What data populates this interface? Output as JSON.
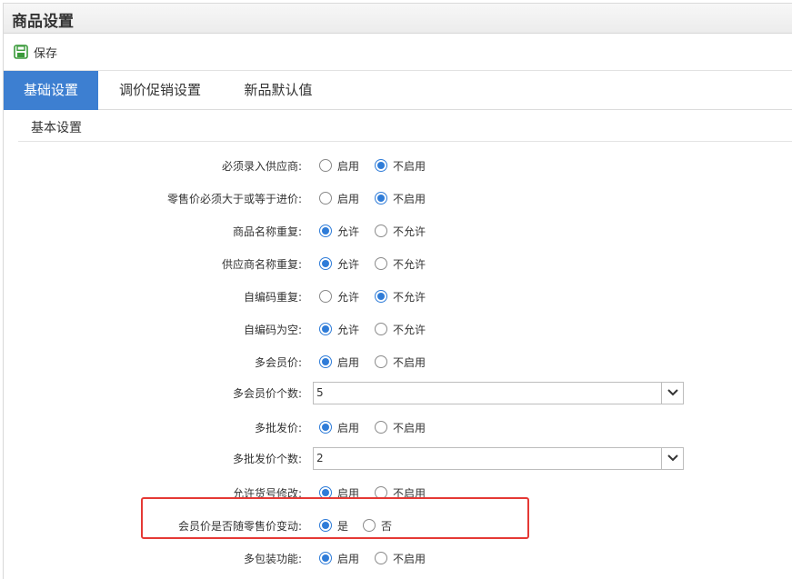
{
  "window": {
    "title": "商品设置"
  },
  "toolbar": {
    "save_label": "保存"
  },
  "tabs": [
    {
      "label": "基础设置",
      "active": true
    },
    {
      "label": "调价促销设置",
      "active": false
    },
    {
      "label": "新品默认值",
      "active": false
    }
  ],
  "section": {
    "title": "基本设置"
  },
  "settings": [
    {
      "label": "必须录入供应商:",
      "options": [
        "启用",
        "不启用"
      ],
      "selected": 1
    },
    {
      "label": "零售价必须大于或等于进价:",
      "options": [
        "启用",
        "不启用"
      ],
      "selected": 1
    },
    {
      "label": "商品名称重复:",
      "options": [
        "允许",
        "不允许"
      ],
      "selected": 0
    },
    {
      "label": "供应商名称重复:",
      "options": [
        "允许",
        "不允许"
      ],
      "selected": 0
    },
    {
      "label": "自编码重复:",
      "options": [
        "允许",
        "不允许"
      ],
      "selected": 1
    },
    {
      "label": "自编码为空:",
      "options": [
        "允许",
        "不允许"
      ],
      "selected": 0
    },
    {
      "label": "多会员价:",
      "options": [
        "启用",
        "不启用"
      ],
      "selected": 0
    },
    {
      "label": "多会员价个数:",
      "value": "5"
    },
    {
      "label": "多批发价:",
      "options": [
        "启用",
        "不启用"
      ],
      "selected": 0
    },
    {
      "label": "多批发价个数:",
      "value": "2"
    },
    {
      "label": "允许货号修改:",
      "options": [
        "启用",
        "不启用"
      ],
      "selected": 0
    },
    {
      "label": "会员价是否随零售价变动:",
      "options": [
        "是",
        "否"
      ],
      "selected": 0
    },
    {
      "label": "多包装功能:",
      "options": [
        "启用",
        "不启用"
      ],
      "selected": 0
    }
  ],
  "colors": {
    "accent": "#3d7fd1",
    "radio_selected": "#2f7cd8",
    "highlight": "#e53935"
  },
  "icons": {
    "save": "floppy-disk-icon",
    "dropdown": "chevron-down-icon"
  }
}
